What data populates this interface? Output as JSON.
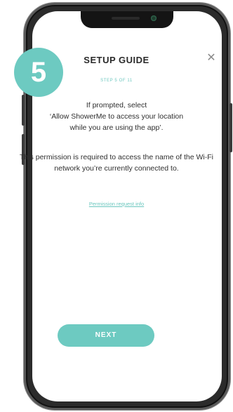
{
  "badge": {
    "step_number": "5"
  },
  "header": {
    "title": "SETUP GUIDE",
    "close_glyph": "✕"
  },
  "step": {
    "label": "STEP 5 OF 11"
  },
  "instruction": {
    "line1": "If prompted, select",
    "line2": "‘Allow ShowerMe to access your location",
    "line3": "while you are using the app’."
  },
  "explanation": {
    "text": "This permission is required to access the name of the Wi-Fi network you’re currently connected to."
  },
  "link": {
    "label": "Permission request info"
  },
  "next_button": {
    "label": "NEXT"
  },
  "colors": {
    "accent": "#6dcac1",
    "text": "#2f2f2f",
    "phone_frame": "#2b2b2b"
  }
}
